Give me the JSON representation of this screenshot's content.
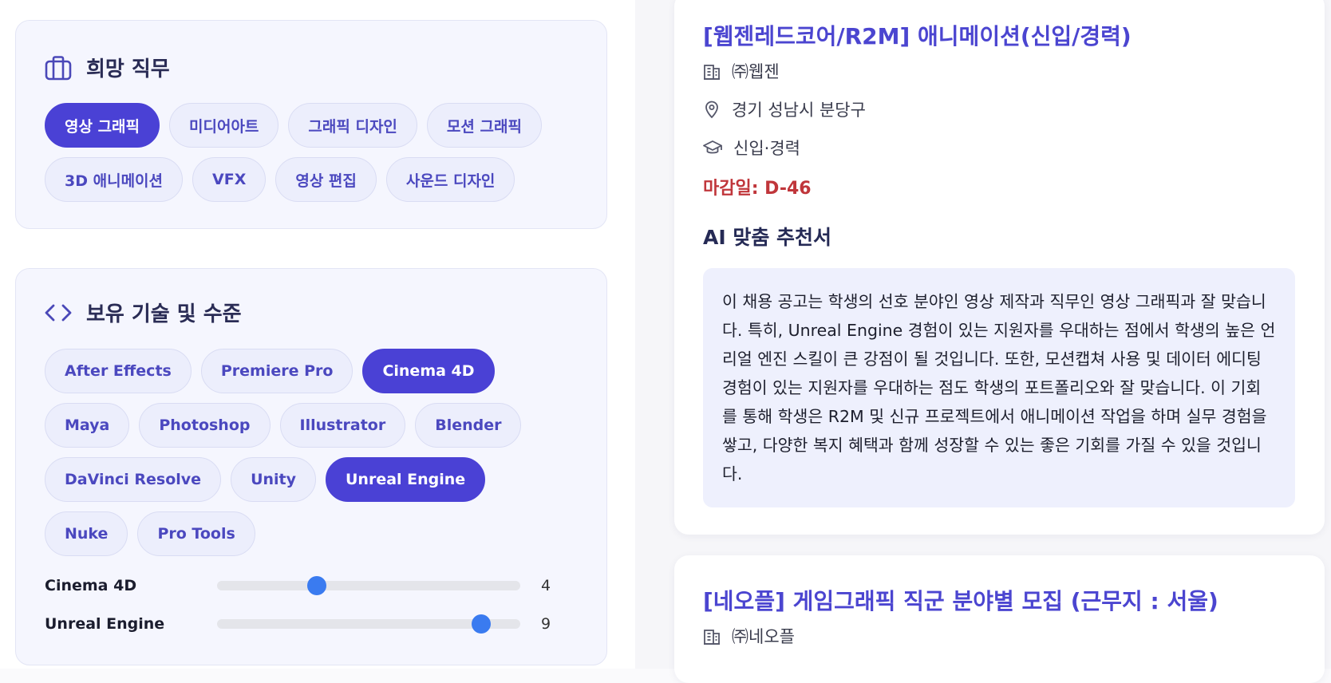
{
  "job_pref": {
    "title": "희망 직무",
    "chips": [
      {
        "label": "영상 그래픽",
        "selected": true
      },
      {
        "label": "미디어아트",
        "selected": false
      },
      {
        "label": "그래픽 디자인",
        "selected": false
      },
      {
        "label": "모션 그래픽",
        "selected": false
      },
      {
        "label": "3D 애니메이션",
        "selected": false
      },
      {
        "label": "VFX",
        "selected": false
      },
      {
        "label": "영상 편집",
        "selected": false
      },
      {
        "label": "사운드 디자인",
        "selected": false
      }
    ]
  },
  "skills": {
    "title": "보유 기술 및 수준",
    "chips": [
      {
        "label": "After Effects",
        "selected": false
      },
      {
        "label": "Premiere Pro",
        "selected": false
      },
      {
        "label": "Cinema 4D",
        "selected": true
      },
      {
        "label": "Maya",
        "selected": false
      },
      {
        "label": "Photoshop",
        "selected": false
      },
      {
        "label": "Illustrator",
        "selected": false
      },
      {
        "label": "Blender",
        "selected": false
      },
      {
        "label": "DaVinci Resolve",
        "selected": false
      },
      {
        "label": "Unity",
        "selected": false
      },
      {
        "label": "Unreal Engine",
        "selected": true
      },
      {
        "label": "Nuke",
        "selected": false
      },
      {
        "label": "Pro Tools",
        "selected": false
      }
    ],
    "levels": [
      {
        "name": "Cinema 4D",
        "value": "4",
        "fraction": 0.33
      },
      {
        "name": "Unreal Engine",
        "value": "9",
        "fraction": 0.87
      }
    ]
  },
  "job1": {
    "title": "[웹젠레드코어/R2M] 애니메이션(신입/경력)",
    "company": "㈜웹젠",
    "location": "경기 성남시 분당구",
    "career": "신입·경력",
    "deadline": "마감일: D-46",
    "rec_heading": "AI 맞춤 추천서",
    "rec_text": "이 채용 공고는 학생의 선호 분야인 영상 제작과 직무인 영상 그래픽과 잘 맞습니다. 특히, Unreal Engine 경험이 있는 지원자를 우대하는 점에서 학생의 높은 언리얼 엔진 스킬이 큰 강점이 될 것입니다. 또한, 모션캡쳐 사용 및 데이터 에디팅 경험이 있는 지원자를 우대하는 점도 학생의 포트폴리오와 잘 맞습니다. 이 기회를 통해 학생은 R2M 및 신규 프로젝트에서 애니메이션 작업을 하며 실무 경험을 쌓고, 다양한 복지 혜택과 함께 성장할 수 있는 좋은 기회를 가질 수 있을 것입니다."
  },
  "job2": {
    "title": "[네오플] 게임그래픽 직군 분야별 모집 (근무지 : 서울)",
    "company": "㈜네오플"
  },
  "colors": {
    "accent": "#4a41d5",
    "slider": "#3a7bf0",
    "deadline": "#c0363b"
  }
}
